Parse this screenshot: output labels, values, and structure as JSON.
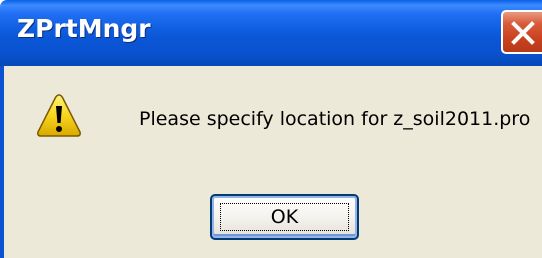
{
  "window": {
    "title": "ZPrtMngr"
  },
  "dialog": {
    "message": "Please specify location for z_soil2011.pro",
    "icon": "warning-icon",
    "ok_label": "OK"
  },
  "colors": {
    "titlebar": "#0a52cf",
    "close_button": "#c8401e",
    "client_background": "#ece9d8",
    "warning_yellow": "#f7d51d"
  }
}
